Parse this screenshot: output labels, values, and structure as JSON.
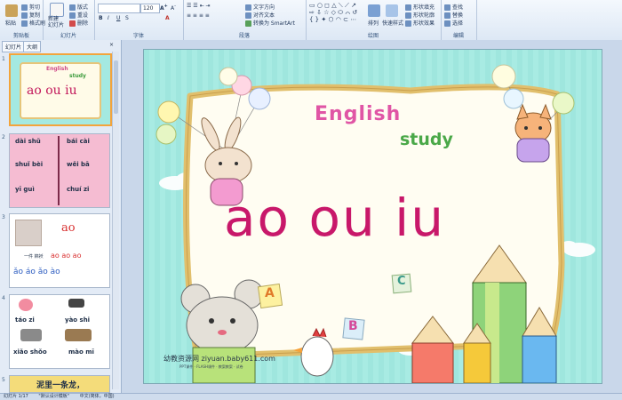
{
  "ribbon": {
    "clipboard": {
      "paste": "粘贴",
      "cut": "剪切",
      "copy": "复制",
      "format_painter": "格式刷",
      "label": "剪贴板"
    },
    "slides": {
      "new_slide": "新建\n幻灯片",
      "layout": "版式",
      "reset": "重设",
      "delete": "删除",
      "label": "幻灯片"
    },
    "font": {
      "size": "120",
      "label": "字体"
    },
    "paragraph": {
      "text_direction": "文字方向",
      "align_text": "对齐文本",
      "smartart": "转换为 SmartArt",
      "label": "段落"
    },
    "drawing": {
      "arrange": "排列",
      "quick_styles": "快速样式",
      "fill": "形状填充",
      "outline": "形状轮廓",
      "effects": "形状效果",
      "label": "绘图"
    },
    "editing": {
      "find": "查找",
      "replace": "替换",
      "select": "选择",
      "label": "编辑"
    }
  },
  "panel": {
    "tabs": [
      "幻灯片",
      "大纲"
    ],
    "thumbs": [
      {
        "num": "1",
        "title": "ao ou iu",
        "sub1": "English",
        "sub2": "study"
      },
      {
        "num": "2",
        "words": [
          "dài shǔ",
          "bái cài",
          "shuǐ bèi",
          "wěi bā",
          "yī guì",
          "chuí zi"
        ]
      },
      {
        "num": "3",
        "big": "ao",
        "line1": "一件 棉袄",
        "line2": "āo áo ǎo ào",
        "line3": "ao ao ao",
        "line4": "ǎo áo ǎo ào"
      },
      {
        "num": "4",
        "words": [
          "táo zi",
          "yào shi",
          "xiǎo shǒo",
          "mào mī"
        ]
      },
      {
        "num": "5",
        "text": "泥里一条龙，"
      }
    ]
  },
  "slide": {
    "main": "ao ou iu",
    "english": "English",
    "study": "study",
    "watermark": "幼教资源网 ziyuan.baby611.com",
    "small_line": "PPT课件 · FLASH课件 · 教案教案 · 试卷",
    "letters": [
      "A",
      "B",
      "C"
    ]
  },
  "status": {
    "slide_count": "幻灯片 1/17",
    "theme": "\"默认设计模板\"",
    "lang": "中文(简体，中国)"
  }
}
